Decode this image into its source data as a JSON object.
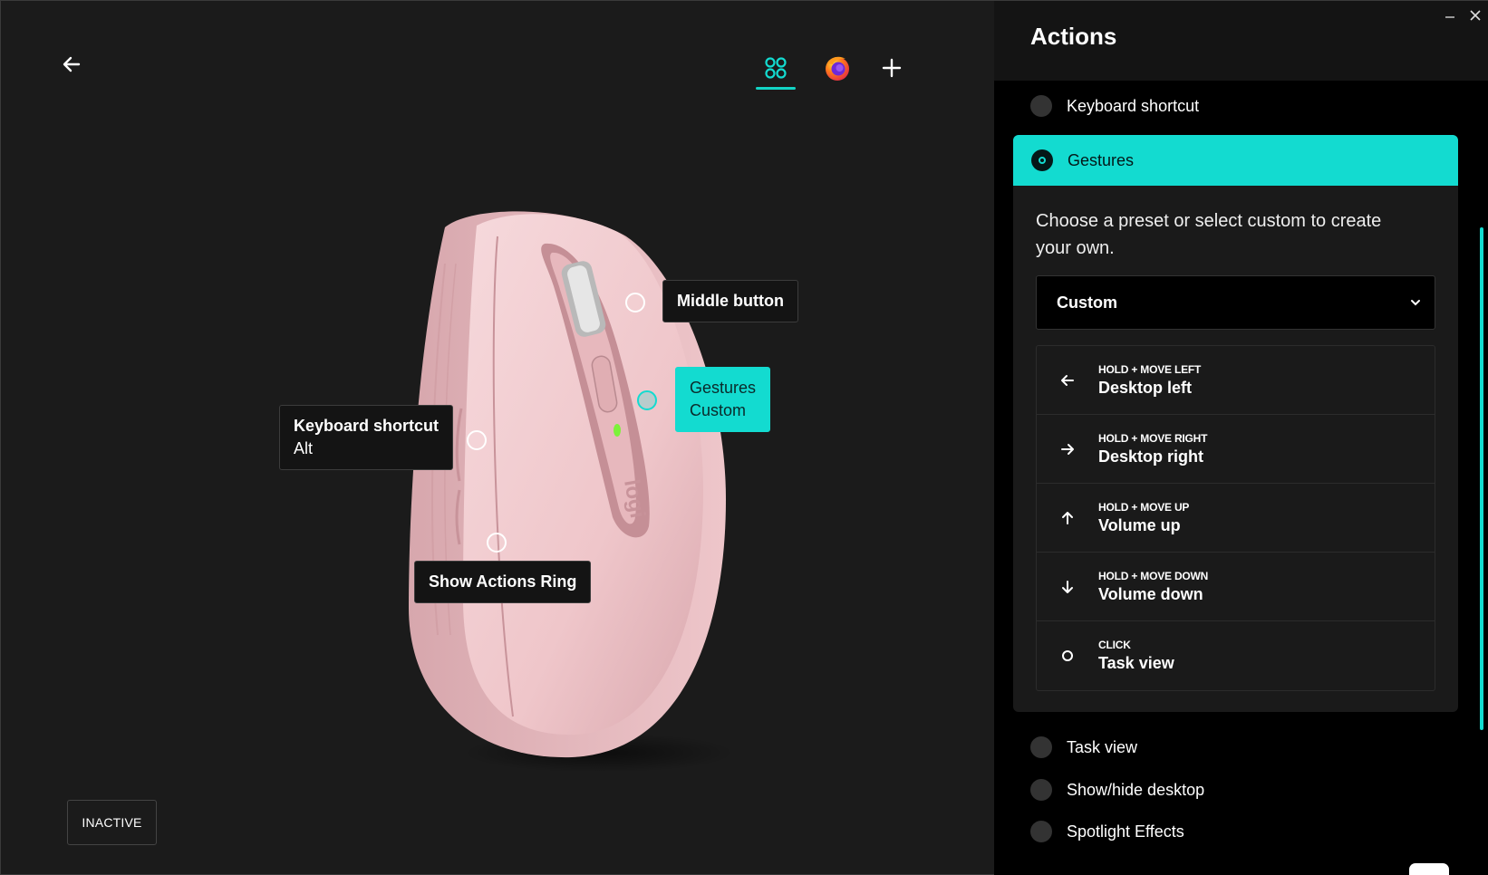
{
  "left": {
    "back_label": "Back",
    "inactive_label": "INACTIVE",
    "app_tabs": [
      {
        "name": "all-applications",
        "icon": "apps-grid-icon"
      },
      {
        "name": "firefox",
        "icon": "firefox-icon"
      },
      {
        "name": "add-application",
        "icon": "plus-icon"
      }
    ],
    "callouts": {
      "middle": {
        "title": "Middle button"
      },
      "gestures": {
        "title": "Gestures",
        "sub": "Custom"
      },
      "keyboard": {
        "title": "Keyboard shortcut",
        "sub": "Alt"
      },
      "actions_ring": {
        "title": "Show Actions Ring"
      }
    }
  },
  "panel": {
    "title": "Actions",
    "options_top": [
      {
        "label": "Keyboard shortcut"
      }
    ],
    "selected": {
      "label": "Gestures",
      "description": "Choose a preset or select custom to create your own.",
      "preset_value": "Custom",
      "gestures": [
        {
          "icon": "arrow-left-icon",
          "trigger": "HOLD + MOVE LEFT",
          "action": "Desktop left"
        },
        {
          "icon": "arrow-right-icon",
          "trigger": "HOLD + MOVE RIGHT",
          "action": "Desktop right"
        },
        {
          "icon": "arrow-up-icon",
          "trigger": "HOLD + MOVE UP",
          "action": "Volume up"
        },
        {
          "icon": "arrow-down-icon",
          "trigger": "HOLD + MOVE DOWN",
          "action": "Volume down"
        },
        {
          "icon": "circle-icon",
          "trigger": "CLICK",
          "action": "Task view"
        }
      ]
    },
    "options_bottom": [
      {
        "label": "Task view"
      },
      {
        "label": "Show/hide desktop"
      },
      {
        "label": "Spotlight Effects"
      }
    ]
  },
  "colors": {
    "accent": "#13dbd0",
    "background": "#1b1b1b",
    "panel": "#000000",
    "mouse": "#f0c9cc"
  }
}
